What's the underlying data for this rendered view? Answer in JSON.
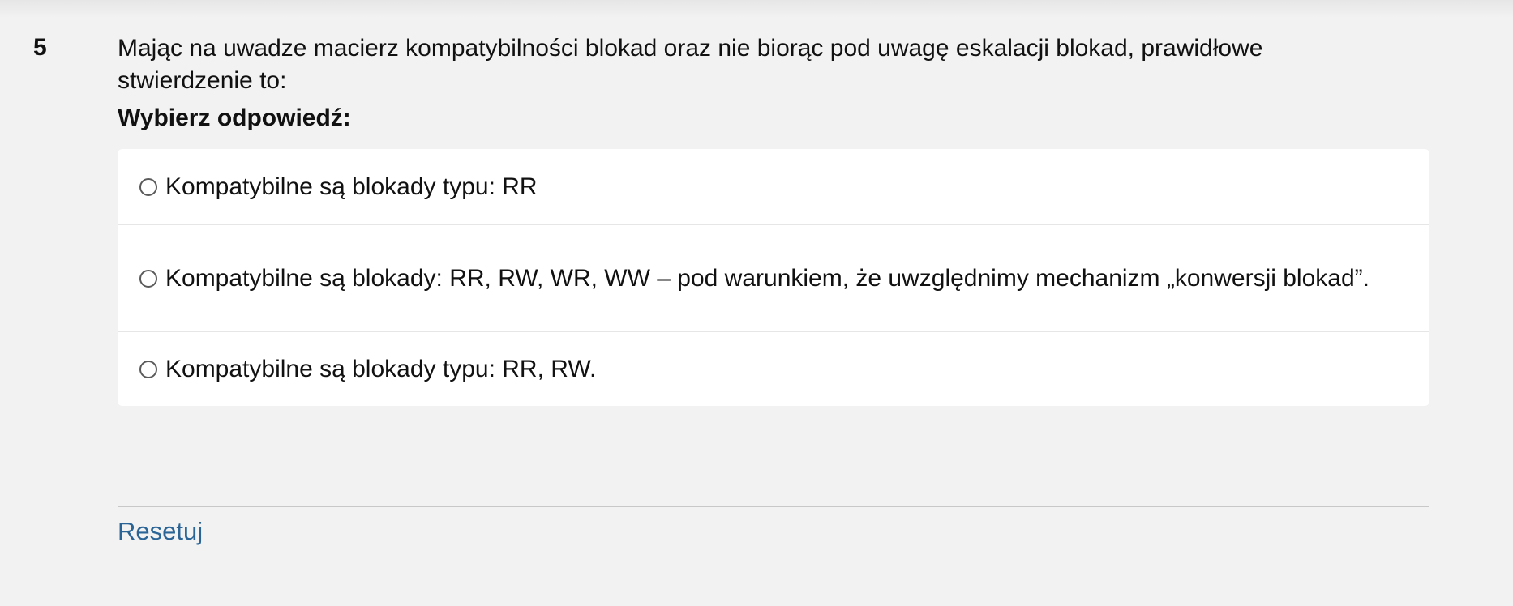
{
  "question": {
    "number": "5",
    "text": "Mając na uwadze macierz kompatybilności blokad oraz nie biorąc pod uwagę eskalacji blokad, prawidłowe stwierdzenie to:",
    "prompt": "Wybierz odpowiedź:",
    "answers": [
      {
        "label": "Kompatybilne są blokady typu: RR",
        "selected": false
      },
      {
        "label": "Kompatybilne są blokady: RR, RW, WR, WW – pod warunkiem, że uwzględnimy mechanizm „konwersji blokad”.",
        "selected": false
      },
      {
        "label": "Kompatybilne są blokady typu: RR, RW.",
        "selected": false
      }
    ]
  },
  "actions": {
    "reset_label": "Resetuj"
  },
  "colors": {
    "background": "#f2f2f2",
    "card": "#ffffff",
    "link": "#2a6496"
  }
}
